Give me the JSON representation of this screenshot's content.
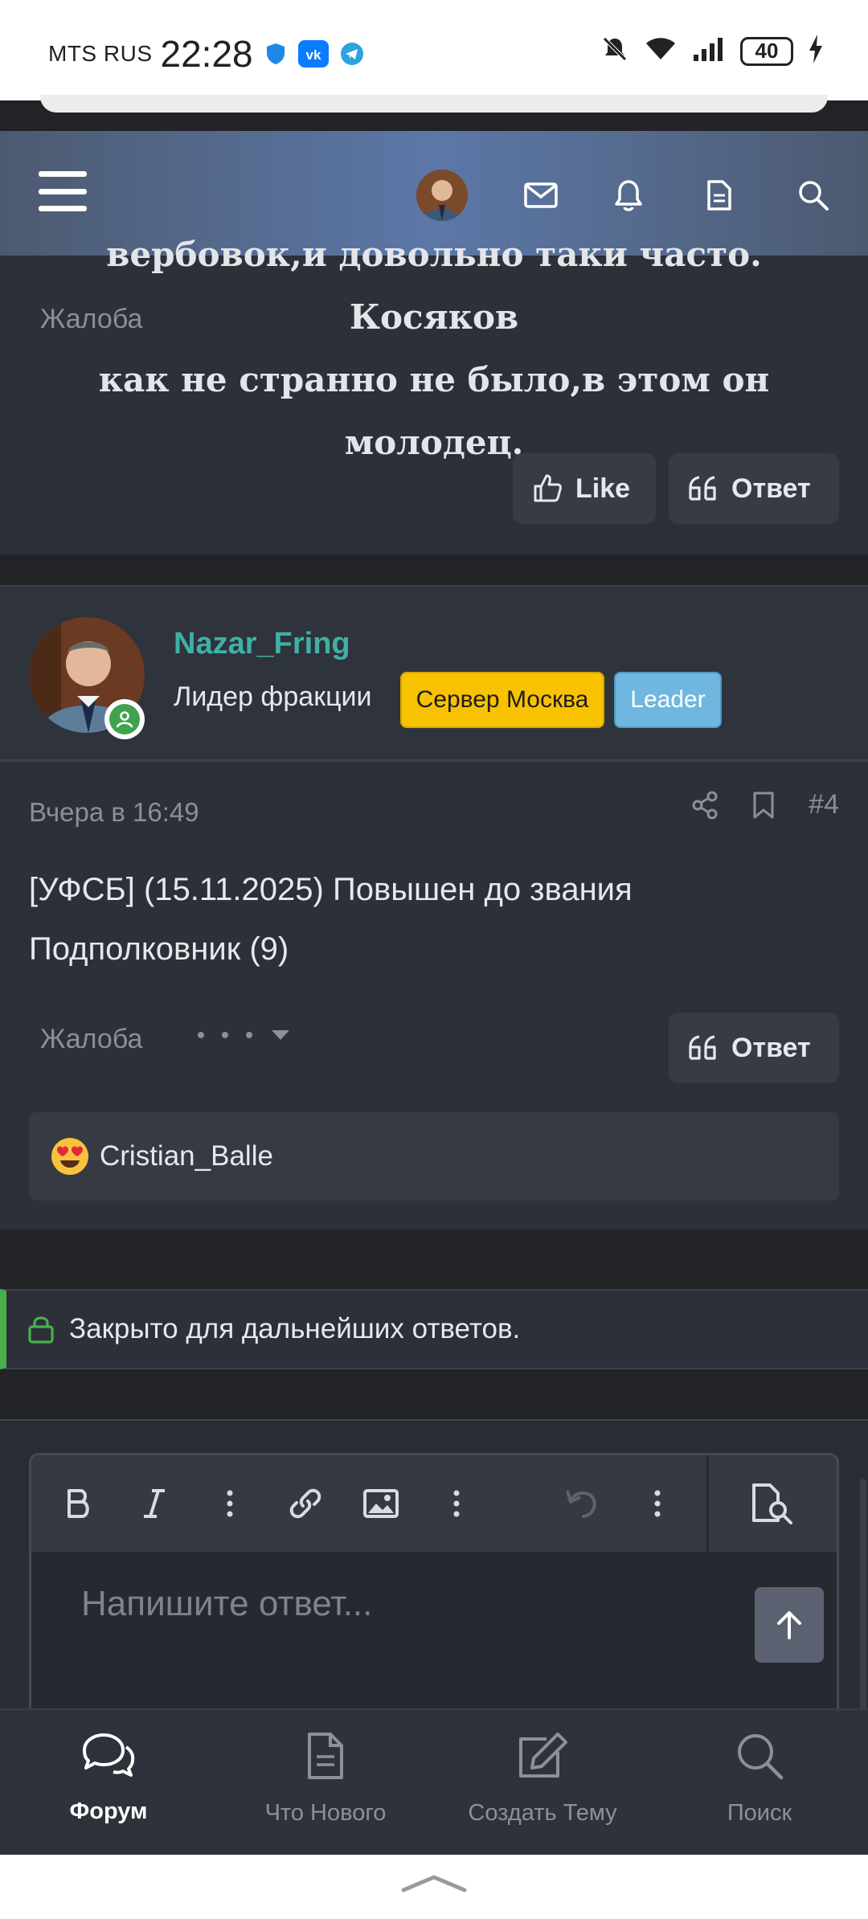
{
  "status_bar": {
    "carrier": "MTS RUS",
    "time": "22:28",
    "battery": "40"
  },
  "post1": {
    "text_lines": [
      "вербовок,и довольно таки часто. Косяков",
      "как не странно не было,в этом он",
      "молодец."
    ],
    "report_label": "Жалоба",
    "like_label": "Like",
    "reply_label": "Ответ"
  },
  "post2": {
    "username": "Nazar_Fring",
    "user_title": "Лидер фракции",
    "badges": [
      "Сервер Москва",
      "Leader"
    ],
    "date": "Вчера в 16:49",
    "post_number": "#4",
    "body_lines": [
      "[УФСБ] (15.11.2025) Повышен до звания",
      "Подполковник (9)"
    ],
    "report_label": "Жалоба",
    "reply_label": "Ответ",
    "reaction_user": "Cristian_Balle"
  },
  "thread_closed_text": "Закрыто для дальнейших ответов.",
  "editor": {
    "placeholder": "Напишите ответ..."
  },
  "bottom_nav": [
    {
      "label": "Форум",
      "icon": "forum-icon",
      "active": true
    },
    {
      "label": "Что Нового",
      "icon": "document-icon",
      "active": false
    },
    {
      "label": "Создать Тему",
      "icon": "edit-icon",
      "active": false
    },
    {
      "label": "Поиск",
      "icon": "search-icon",
      "active": false
    }
  ],
  "colors": {
    "accent_username": "#3fb0a6",
    "badge_server": "#f8c200",
    "badge_leader": "#6fb7df",
    "closed_accent": "#47b04b"
  }
}
